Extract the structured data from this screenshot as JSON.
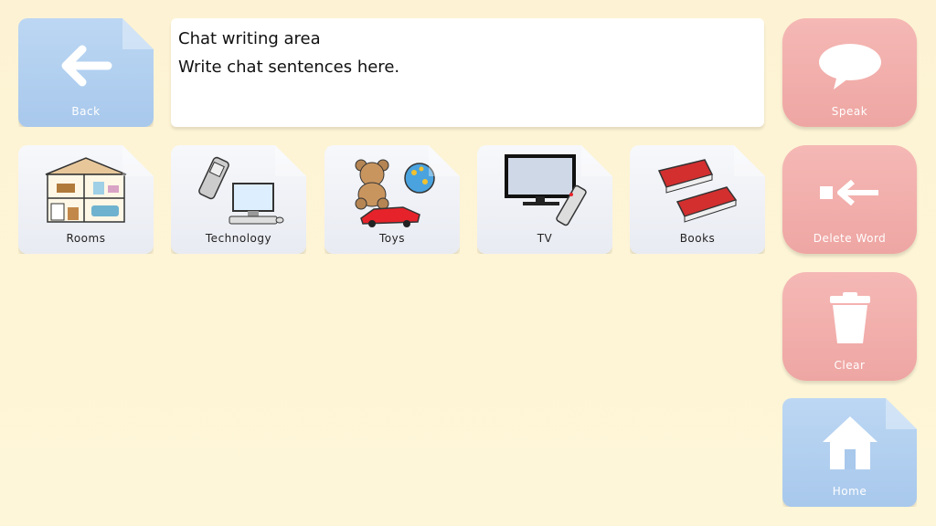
{
  "buttons": {
    "back": "Back",
    "speak": "Speak",
    "delete_word": "Delete Word",
    "clear": "Clear",
    "home": "Home"
  },
  "chat": {
    "title": "Chat writing area",
    "text": "Write chat sentences here."
  },
  "categories": [
    {
      "label": "Rooms"
    },
    {
      "label": "Technology"
    },
    {
      "label": "Toys"
    },
    {
      "label": "TV"
    },
    {
      "label": "Books"
    }
  ],
  "colors": {
    "nav_blue": "#a8c8ec",
    "action_red": "#eea6a3",
    "background": "#fdf3d4"
  }
}
